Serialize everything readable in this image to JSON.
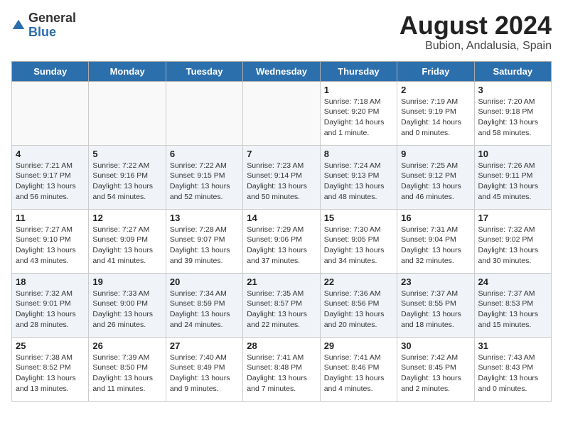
{
  "logo": {
    "general": "General",
    "blue": "Blue"
  },
  "title": "August 2024",
  "location": "Bubion, Andalusia, Spain",
  "days_of_week": [
    "Sunday",
    "Monday",
    "Tuesday",
    "Wednesday",
    "Thursday",
    "Friday",
    "Saturday"
  ],
  "weeks": [
    [
      {
        "day": "",
        "info": ""
      },
      {
        "day": "",
        "info": ""
      },
      {
        "day": "",
        "info": ""
      },
      {
        "day": "",
        "info": ""
      },
      {
        "day": "1",
        "info": "Sunrise: 7:18 AM\nSunset: 9:20 PM\nDaylight: 14 hours\nand 1 minute."
      },
      {
        "day": "2",
        "info": "Sunrise: 7:19 AM\nSunset: 9:19 PM\nDaylight: 14 hours\nand 0 minutes."
      },
      {
        "day": "3",
        "info": "Sunrise: 7:20 AM\nSunset: 9:18 PM\nDaylight: 13 hours\nand 58 minutes."
      }
    ],
    [
      {
        "day": "4",
        "info": "Sunrise: 7:21 AM\nSunset: 9:17 PM\nDaylight: 13 hours\nand 56 minutes."
      },
      {
        "day": "5",
        "info": "Sunrise: 7:22 AM\nSunset: 9:16 PM\nDaylight: 13 hours\nand 54 minutes."
      },
      {
        "day": "6",
        "info": "Sunrise: 7:22 AM\nSunset: 9:15 PM\nDaylight: 13 hours\nand 52 minutes."
      },
      {
        "day": "7",
        "info": "Sunrise: 7:23 AM\nSunset: 9:14 PM\nDaylight: 13 hours\nand 50 minutes."
      },
      {
        "day": "8",
        "info": "Sunrise: 7:24 AM\nSunset: 9:13 PM\nDaylight: 13 hours\nand 48 minutes."
      },
      {
        "day": "9",
        "info": "Sunrise: 7:25 AM\nSunset: 9:12 PM\nDaylight: 13 hours\nand 46 minutes."
      },
      {
        "day": "10",
        "info": "Sunrise: 7:26 AM\nSunset: 9:11 PM\nDaylight: 13 hours\nand 45 minutes."
      }
    ],
    [
      {
        "day": "11",
        "info": "Sunrise: 7:27 AM\nSunset: 9:10 PM\nDaylight: 13 hours\nand 43 minutes."
      },
      {
        "day": "12",
        "info": "Sunrise: 7:27 AM\nSunset: 9:09 PM\nDaylight: 13 hours\nand 41 minutes."
      },
      {
        "day": "13",
        "info": "Sunrise: 7:28 AM\nSunset: 9:07 PM\nDaylight: 13 hours\nand 39 minutes."
      },
      {
        "day": "14",
        "info": "Sunrise: 7:29 AM\nSunset: 9:06 PM\nDaylight: 13 hours\nand 37 minutes."
      },
      {
        "day": "15",
        "info": "Sunrise: 7:30 AM\nSunset: 9:05 PM\nDaylight: 13 hours\nand 34 minutes."
      },
      {
        "day": "16",
        "info": "Sunrise: 7:31 AM\nSunset: 9:04 PM\nDaylight: 13 hours\nand 32 minutes."
      },
      {
        "day": "17",
        "info": "Sunrise: 7:32 AM\nSunset: 9:02 PM\nDaylight: 13 hours\nand 30 minutes."
      }
    ],
    [
      {
        "day": "18",
        "info": "Sunrise: 7:32 AM\nSunset: 9:01 PM\nDaylight: 13 hours\nand 28 minutes."
      },
      {
        "day": "19",
        "info": "Sunrise: 7:33 AM\nSunset: 9:00 PM\nDaylight: 13 hours\nand 26 minutes."
      },
      {
        "day": "20",
        "info": "Sunrise: 7:34 AM\nSunset: 8:59 PM\nDaylight: 13 hours\nand 24 minutes."
      },
      {
        "day": "21",
        "info": "Sunrise: 7:35 AM\nSunset: 8:57 PM\nDaylight: 13 hours\nand 22 minutes."
      },
      {
        "day": "22",
        "info": "Sunrise: 7:36 AM\nSunset: 8:56 PM\nDaylight: 13 hours\nand 20 minutes."
      },
      {
        "day": "23",
        "info": "Sunrise: 7:37 AM\nSunset: 8:55 PM\nDaylight: 13 hours\nand 18 minutes."
      },
      {
        "day": "24",
        "info": "Sunrise: 7:37 AM\nSunset: 8:53 PM\nDaylight: 13 hours\nand 15 minutes."
      }
    ],
    [
      {
        "day": "25",
        "info": "Sunrise: 7:38 AM\nSunset: 8:52 PM\nDaylight: 13 hours\nand 13 minutes."
      },
      {
        "day": "26",
        "info": "Sunrise: 7:39 AM\nSunset: 8:50 PM\nDaylight: 13 hours\nand 11 minutes."
      },
      {
        "day": "27",
        "info": "Sunrise: 7:40 AM\nSunset: 8:49 PM\nDaylight: 13 hours\nand 9 minutes."
      },
      {
        "day": "28",
        "info": "Sunrise: 7:41 AM\nSunset: 8:48 PM\nDaylight: 13 hours\nand 7 minutes."
      },
      {
        "day": "29",
        "info": "Sunrise: 7:41 AM\nSunset: 8:46 PM\nDaylight: 13 hours\nand 4 minutes."
      },
      {
        "day": "30",
        "info": "Sunrise: 7:42 AM\nSunset: 8:45 PM\nDaylight: 13 hours\nand 2 minutes."
      },
      {
        "day": "31",
        "info": "Sunrise: 7:43 AM\nSunset: 8:43 PM\nDaylight: 13 hours\nand 0 minutes."
      }
    ]
  ]
}
